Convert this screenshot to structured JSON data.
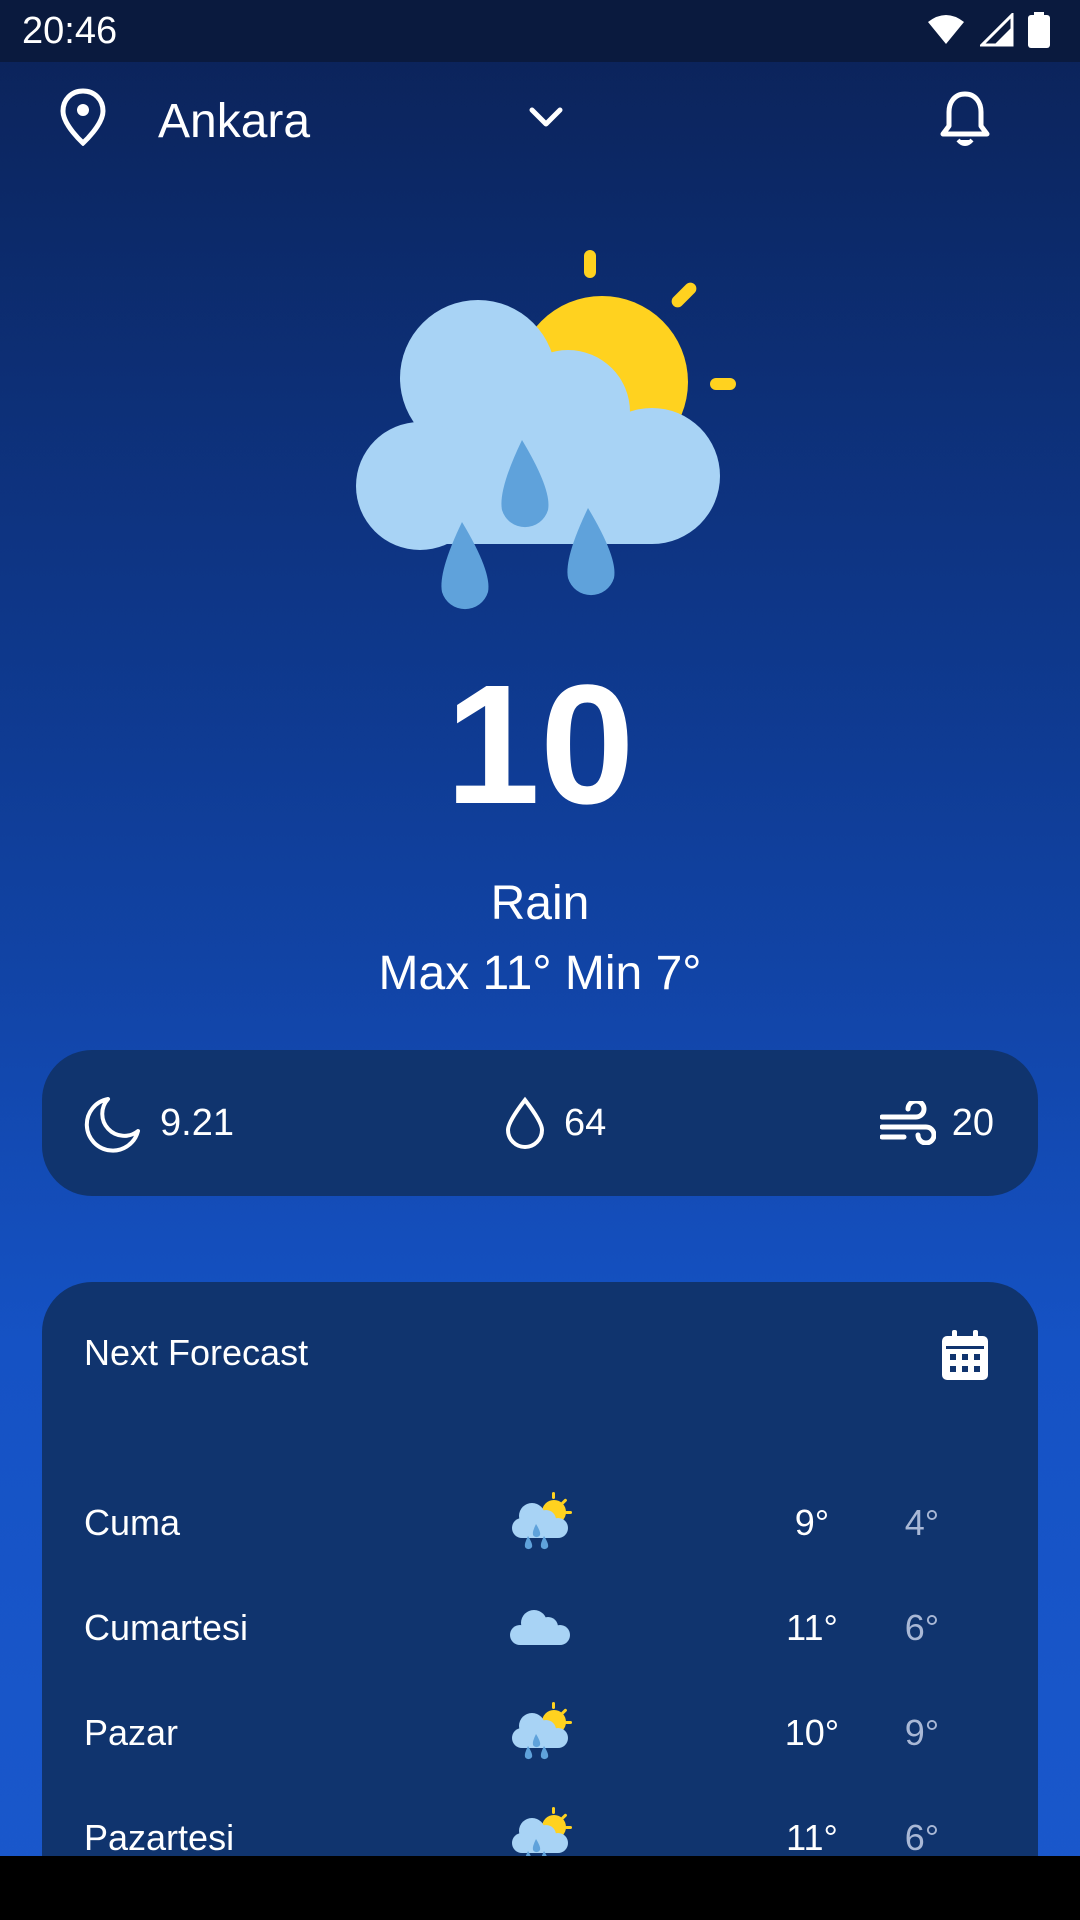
{
  "status": {
    "time": "20:46"
  },
  "header": {
    "city": "Ankara"
  },
  "current": {
    "temperature": "10",
    "condition": "Rain",
    "max_min": "Max 11°  Min 7°"
  },
  "stats": {
    "moon": "9.21",
    "humidity": "64",
    "wind": "20"
  },
  "forecast": {
    "title": "Next Forecast",
    "days": [
      {
        "day": "Cuma",
        "icon": "sun-cloud-rain-icon",
        "max": "9°",
        "min": "4°"
      },
      {
        "day": "Cumartesi",
        "icon": "cloud-icon",
        "max": "11°",
        "min": "6°"
      },
      {
        "day": "Pazar",
        "icon": "sun-cloud-rain-icon",
        "max": "10°",
        "min": "9°"
      },
      {
        "day": "Pazartesi",
        "icon": "sun-cloud-rain-icon",
        "max": "11°",
        "min": "6°"
      }
    ]
  },
  "colors": {
    "sun": "#FFD21F",
    "cloud": "#A8D3F5",
    "rain": "#5FA2DB",
    "card": "#10346E"
  }
}
